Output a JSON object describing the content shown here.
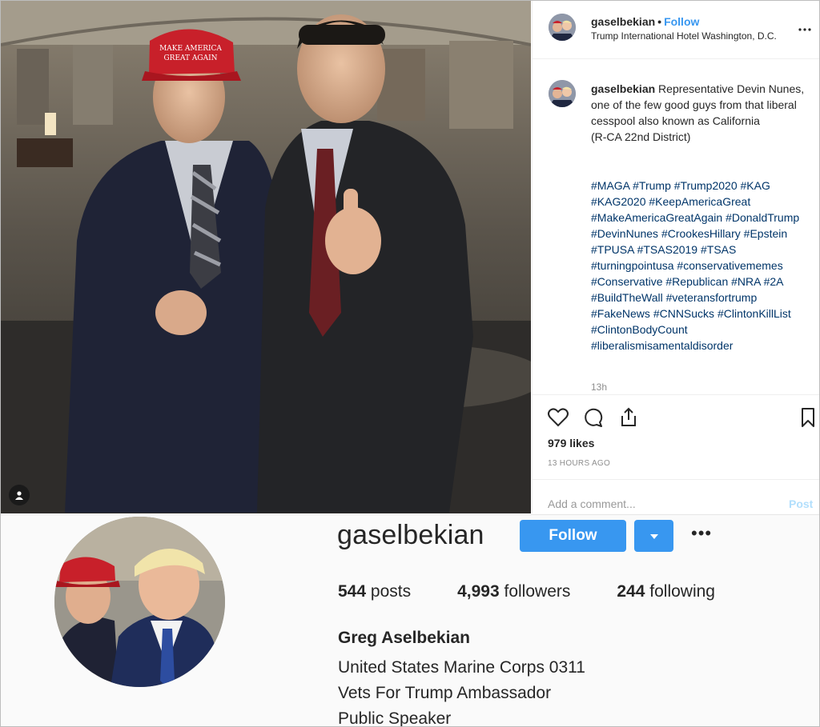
{
  "post": {
    "username": "gaselbekian",
    "follow_label": "Follow",
    "separator": "•",
    "location": "Trump International Hotel Washington, D.C.",
    "more_icon": "more-horizontal-icon",
    "caption_username": "gaselbekian",
    "caption_text": "Representative Devin Nunes, one of the few good guys from that liberal cesspool also known as California",
    "caption_district": "(R-CA 22nd District)",
    "hashtags": [
      "#MAGA",
      "#Trump",
      "#Trump2020",
      "#KAG",
      "#KAG2020",
      "#KeepAmericaGreat",
      "#MakeAmericaGreatAgain",
      "#DonaldTrump",
      "#DevinNunes",
      "#CrookesHillary",
      "#Epstein",
      "#TPUSA",
      "#TSAS2019",
      "#TSAS",
      "#turningpointusa",
      "#conservativememes",
      "#Conservative",
      "#Republican",
      "#NRA",
      "#2A",
      "#BuildTheWall",
      "#veteransfortrump",
      "#FakeNews",
      "#CNNSucks",
      "#ClintonKillList",
      "#ClintonBodyCount",
      "#liberalismisamentaldisorder"
    ],
    "comment_time": "13h",
    "likes": "979 likes",
    "posted_time": "13 HOURS AGO",
    "comment_placeholder": "Add a comment...",
    "post_button": "Post",
    "photo_hat_text_line1": "MAKE AMERICA",
    "photo_hat_text_line2": "GREAT AGAIN"
  },
  "profile": {
    "username": "gaselbekian",
    "follow_label": "Follow",
    "more_label": "•••",
    "posts_count": "544",
    "posts_label": "posts",
    "followers_count": "4,993",
    "followers_label": "followers",
    "following_count": "244",
    "following_label": "following",
    "full_name": "Greg Aselbekian",
    "bio_lines": [
      "United States Marine Corps 0311",
      "Vets For Trump Ambassador",
      "Public Speaker"
    ]
  },
  "colors": {
    "accent": "#3897f0",
    "hashtag": "#003569",
    "hat_red": "#c8202a"
  }
}
